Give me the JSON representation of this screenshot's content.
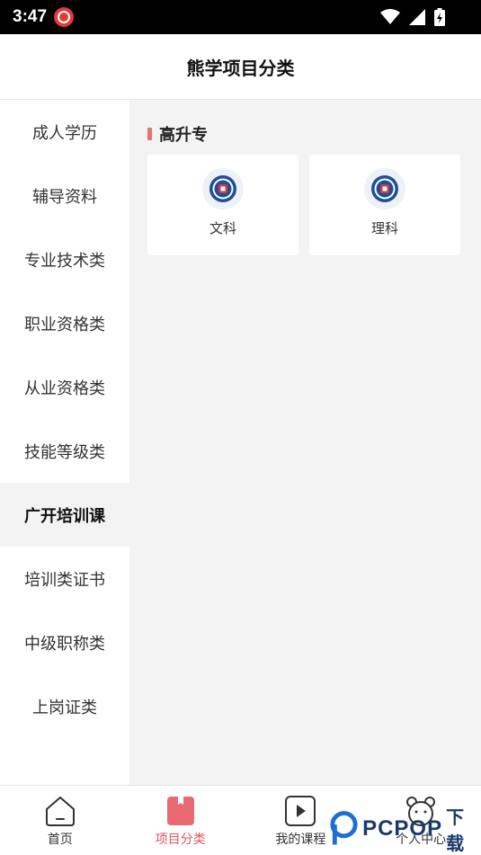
{
  "status_bar": {
    "time": "3:47"
  },
  "header": {
    "title": "熊学项目分类"
  },
  "sidebar": {
    "items": [
      {
        "label": "成人学历",
        "active": false
      },
      {
        "label": "辅导资料",
        "active": false
      },
      {
        "label": "专业技术类",
        "active": false
      },
      {
        "label": "职业资格类",
        "active": false
      },
      {
        "label": "从业资格类",
        "active": false
      },
      {
        "label": "技能等级类",
        "active": false
      },
      {
        "label": "广开培训课",
        "active": true
      },
      {
        "label": "培训类证书",
        "active": false
      },
      {
        "label": "中级职称类",
        "active": false
      },
      {
        "label": "上岗证类",
        "active": false
      }
    ]
  },
  "content": {
    "section_title": "高升专",
    "cards": [
      {
        "label": "文科"
      },
      {
        "label": "理科"
      }
    ]
  },
  "tabbar": {
    "tabs": [
      {
        "label": "首页",
        "icon": "home-icon"
      },
      {
        "label": "项目分类",
        "icon": "bookmark-icon",
        "active": true
      },
      {
        "label": "我的课程",
        "icon": "play-icon"
      },
      {
        "label": "个人中心",
        "icon": "bear-icon"
      }
    ]
  },
  "watermark": {
    "brand": "PCPOP",
    "suffix": "下载"
  },
  "colors": {
    "accent": "#e05561",
    "sidebar_active_bg": "#f3f3f3",
    "content_bg": "#f3f3f3"
  }
}
